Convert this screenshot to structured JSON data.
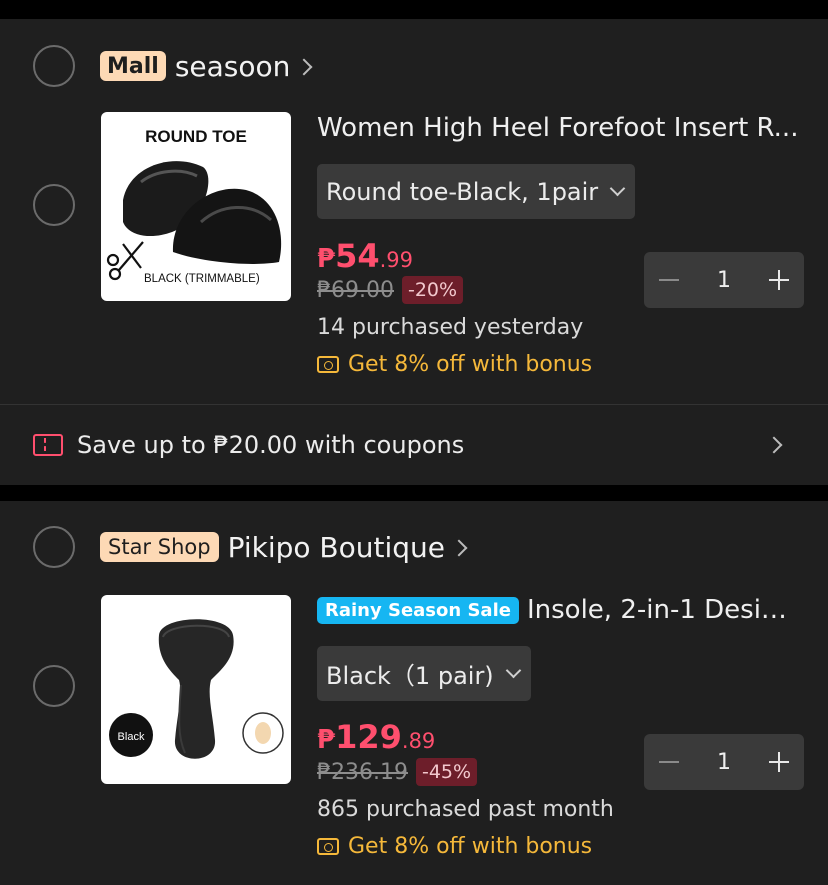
{
  "stores": [
    {
      "badge": "Mall",
      "name": "seasoon",
      "product": {
        "image_text": {
          "heading": "ROUND TOE",
          "caption": "BLACK (TRIMMABLE)"
        },
        "title": "Women High Heel Forefoot Insert R...",
        "variant": "Round toe-Black, 1pair",
        "price": {
          "currency": "₱",
          "integer": "54",
          "decimal": ".99"
        },
        "original_price": "₱69.00",
        "discount": "-20%",
        "sold": "14 purchased yesterday",
        "bonus": "Get 8% off with bonus",
        "quantity": "1"
      },
      "coupon": "Save up to ₱20.00 with coupons"
    },
    {
      "badge": "Star Shop",
      "name": "Pikipo Boutique",
      "product": {
        "sale_badge": "Rainy Season Sale",
        "image_text": {
          "label": "Black"
        },
        "title": "Insole, 2-in-1 Design,...",
        "variant": "Black（1 pair)",
        "price": {
          "currency": "₱",
          "integer": "129",
          "decimal": ".89"
        },
        "original_price": "₱236.19",
        "discount": "-45%",
        "sold": "865 purchased past month",
        "bonus": "Get 8% off with bonus",
        "quantity": "1"
      }
    }
  ],
  "colors": {
    "accent_price": "#ff4f6e",
    "bonus": "#f5b83a",
    "badge_mall": "#fdd9b5",
    "sale_badge": "#16b6f2"
  }
}
